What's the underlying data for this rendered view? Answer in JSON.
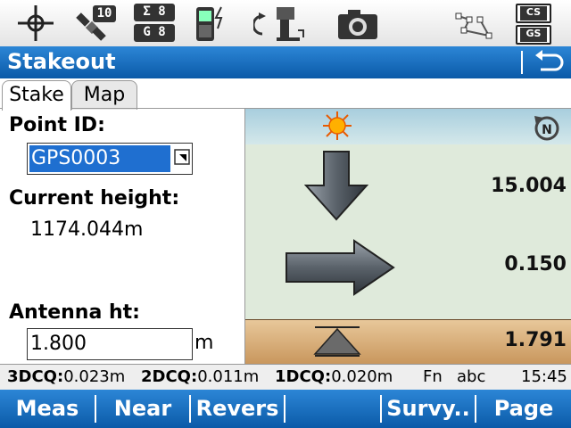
{
  "status": {
    "sat_count": "10",
    "sigma": "Σ 8",
    "gps": "G 8",
    "cs_label": "CS",
    "gs_label": "GS",
    "icons": [
      "crosshair-icon",
      "satellite-icon",
      "controller-icon",
      "instrument-icon",
      "camera-icon",
      "polygon-icon"
    ]
  },
  "title": "Stakeout",
  "tabs": [
    {
      "label": "Stake",
      "active": true
    },
    {
      "label": "Map",
      "active": false
    }
  ],
  "form": {
    "point_id_label": "Point ID:",
    "point_id_value": "GPS0003",
    "current_height_label": "Current height:",
    "current_height_value": "1174.044m",
    "antenna_label": "Antenna ht:",
    "antenna_value": "1.800",
    "antenna_unit": "m"
  },
  "guidance": {
    "down_value": "15.004",
    "right_value": "0.150",
    "height_value": "1.791"
  },
  "info": {
    "q3_label": "3DCQ:",
    "q3_value": "0.023m",
    "q2_label": "2DCQ:",
    "q2_value": "0.011m",
    "q1_label": "1DCQ:",
    "q1_value": "0.020m",
    "fn": "Fn",
    "input_mode": "abc",
    "time": "15:45"
  },
  "softkeys": {
    "meas": "Meas",
    "near": "Near",
    "revers": "Revers",
    "survy": "Survy..",
    "page": "Page"
  }
}
